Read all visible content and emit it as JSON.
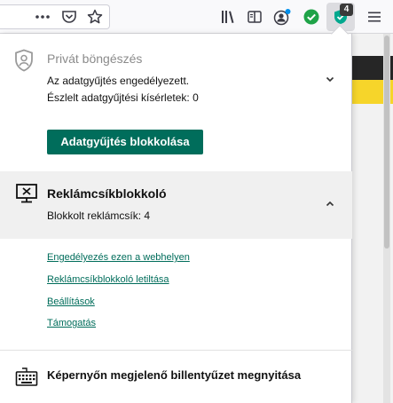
{
  "toolbar": {
    "icons": [
      "more-icon",
      "pocket-icon",
      "bookmark-star-icon",
      "library-icon",
      "reader-icon",
      "account-icon",
      "check-extension-icon",
      "kaspersky-shield-icon",
      "menu-icon"
    ],
    "extension_badge": "4"
  },
  "privacy": {
    "title": "Privát böngészés",
    "line1": "Az adatgyűjtés engedélyezett.",
    "line2": "Észlelt adatgyűjtési kísérletek: 0",
    "button_label": "Adatgyűjtés blokkolása"
  },
  "adblock": {
    "title": "Reklámcsíkblokkoló",
    "subtitle": "Blokkolt reklámcsík: 4",
    "links": [
      "Engedélyezés ezen a webhelyen",
      "Reklámcsíkblokkoló letiltása",
      "Beállítások",
      "Támogatás"
    ]
  },
  "keyboard": {
    "title": "Képernyőn megjelenő billentyűzet megnyitása"
  },
  "colors": {
    "accent": "#006d5b",
    "section_bg": "#f0f0f0",
    "check_green": "#1fa348",
    "strip_yellow": "#f6d52a"
  }
}
